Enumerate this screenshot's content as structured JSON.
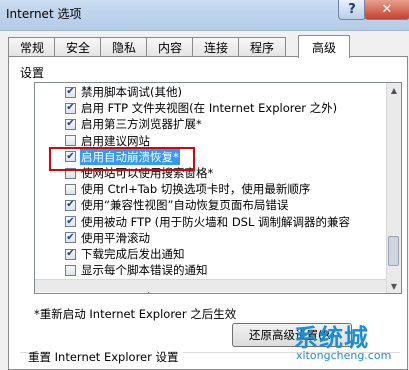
{
  "window": {
    "title": "Internet 选项",
    "help_glyph": "?",
    "close_glyph": "✕"
  },
  "tabs": [
    {
      "label": "常规"
    },
    {
      "label": "安全"
    },
    {
      "label": "隐私"
    },
    {
      "label": "内容"
    },
    {
      "label": "连接"
    },
    {
      "label": "程序"
    },
    {
      "label": "高级",
      "active": true
    }
  ],
  "settings": {
    "group_label": "设置",
    "items": [
      {
        "label": "禁用脚本调试(其他)",
        "checked": true
      },
      {
        "label": "启用 FTP 文件夹视图(在 Internet Explorer 之外)",
        "checked": true
      },
      {
        "label": "启用第三方浏览器扩展*",
        "checked": true
      },
      {
        "label": "启用建议网站",
        "checked": false
      },
      {
        "label": "启用自动崩溃恢复*",
        "checked": true,
        "highlighted": true
      },
      {
        "label": "使网站可以使用搜索窗格*",
        "checked": false
      },
      {
        "label": "使用 Ctrl+Tab 切换选项卡时，使用最新顺序",
        "checked": false
      },
      {
        "label": "使用“兼容性视图”自动恢复页面布局错误",
        "checked": true
      },
      {
        "label": "使用被动 FTP (用于防火墙和 DSL 调制解调器的兼容",
        "checked": true
      },
      {
        "label": "使用平滑滚动",
        "checked": true
      },
      {
        "label": "下载完成后发出通知",
        "checked": true
      },
      {
        "label": "显示每个脚本错误的通知",
        "checked": false
      },
      {
        "label": "显示友好 http 错误信息",
        "checked": true
      }
    ],
    "restart_note": "*重新启动 Internet Explorer 之后生效",
    "restore_button": "还原高级设置(R)"
  },
  "reset": {
    "label": "重置 Internet Explorer 设置"
  },
  "watermark": {
    "brand": "系统城",
    "url": "xitongcheng.com"
  },
  "colors": {
    "highlight": "#3399ff",
    "annotation_box": "#e00000",
    "watermark": "#1a8fd8"
  }
}
